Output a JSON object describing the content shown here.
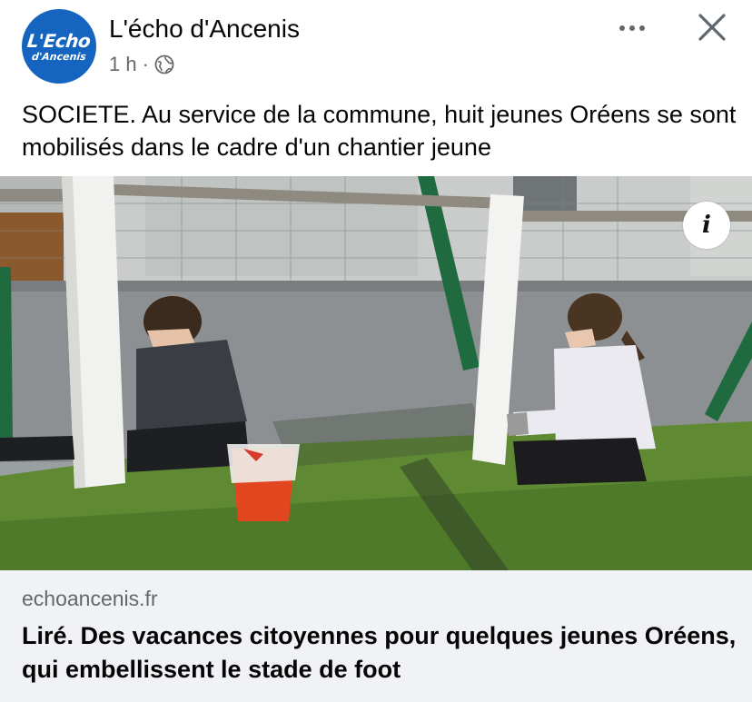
{
  "post": {
    "page_name": "L'écho d'Ancenis",
    "avatar_line1": "L'Echo",
    "avatar_line2": "d'Ancenis",
    "time": "1 h",
    "separator": "·",
    "audience_icon": "globe-icon",
    "caption": "SOCIETE. Au service de la commune, huit jeunes Oréens se sont mobilisés dans le cadre d'un chantier jeune"
  },
  "actions": {
    "more_icon": "more-dots-icon",
    "close_icon": "close-icon"
  },
  "media": {
    "info_label": "i"
  },
  "link": {
    "domain": "echoancenis.fr",
    "headline": "Liré. Des vacances citoyennes pour quelques jeunes Oréens, qui embellissent le stade de foot"
  },
  "colors": {
    "brand_blue": "#1565c0",
    "secondary_text": "#65676b",
    "link_background": "#f0f2f5"
  }
}
